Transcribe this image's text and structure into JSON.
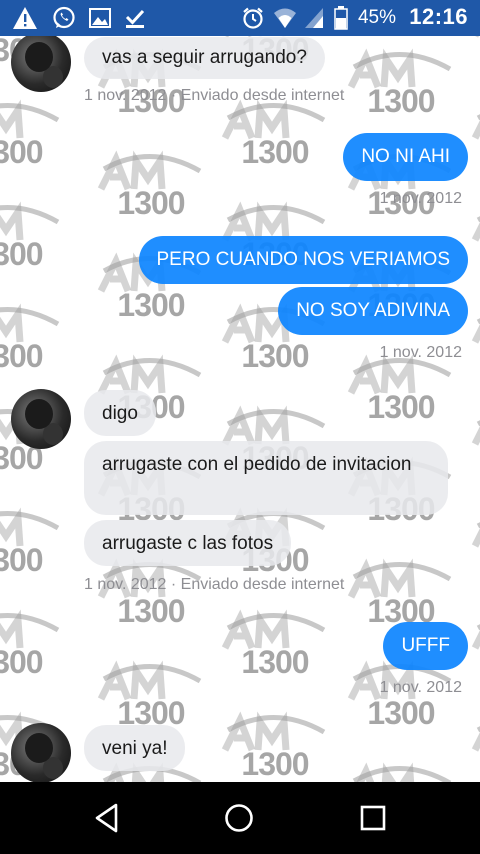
{
  "status_bar": {
    "icons": [
      "warning-icon",
      "whatsapp-icon",
      "gallery-icon",
      "check-download-icon",
      "alarm-icon",
      "wifi-icon",
      "signal-icon",
      "battery-icon"
    ],
    "battery": "45%",
    "time": "12:16"
  },
  "watermark": {
    "text": "1300",
    "brand": "AM"
  },
  "messages": [
    {
      "text": "vas a seguir arrugando?"
    },
    {
      "meta": "1 nov. 2012 · Enviado desde internet"
    },
    {
      "text": "NO NI AHI"
    },
    {
      "meta": "1 nov. 2012"
    },
    {
      "text": "PERO CUANDO NOS VERIAMOS"
    },
    {
      "text": "NO SOY ADIVINA"
    },
    {
      "meta": "1 nov. 2012"
    },
    {
      "text": "digo"
    },
    {
      "text": "arrugaste con el pedido de invitacion"
    },
    {
      "text": "arrugaste c las fotos"
    },
    {
      "meta": "1 nov. 2012 · Enviado desde internet"
    },
    {
      "text": "UFFF"
    },
    {
      "meta": "1 nov. 2012"
    },
    {
      "text": "veni ya!"
    }
  ],
  "nav_bar": {
    "buttons": [
      "back-icon",
      "home-icon",
      "recents-icon"
    ]
  }
}
